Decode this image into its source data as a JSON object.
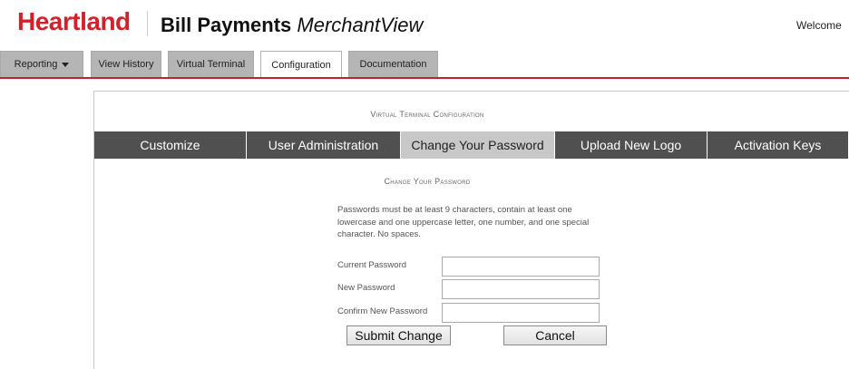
{
  "header": {
    "logo": "Heartland",
    "product_bold": "Bill Payments",
    "product_italic": "MerchantView",
    "welcome": "Welcome"
  },
  "nav": {
    "tabs": [
      {
        "label": "Reporting"
      },
      {
        "label": "View History"
      },
      {
        "label": "Virtual Terminal"
      },
      {
        "label": "Configuration",
        "active": true
      },
      {
        "label": "Documentation"
      }
    ]
  },
  "panel": {
    "title": "Virtual Terminal Configuration",
    "subtabs": [
      {
        "label": "Customize"
      },
      {
        "label": "User Administration"
      },
      {
        "label": "Change Your Password",
        "active": true
      },
      {
        "label": "Upload New Logo"
      },
      {
        "label": "Activation Keys"
      }
    ]
  },
  "form": {
    "section_title": "Change Your Password",
    "info": "Passwords must be at least 9 characters, contain at least one lowercase and one uppercase letter, one number, and one special character. No spaces.",
    "current_label": "Current Password",
    "current_value": "",
    "new_label": "New Password",
    "new_value": "",
    "confirm_label": "Confirm New Password",
    "confirm_value": "",
    "submit_label": "Submit Change",
    "cancel_label": "Cancel"
  },
  "colors": {
    "brand_red": "#d2212b",
    "subtab_dark": "#505050",
    "subtab_active": "#c8c8c8",
    "nav_tab": "#b5b5b5"
  }
}
